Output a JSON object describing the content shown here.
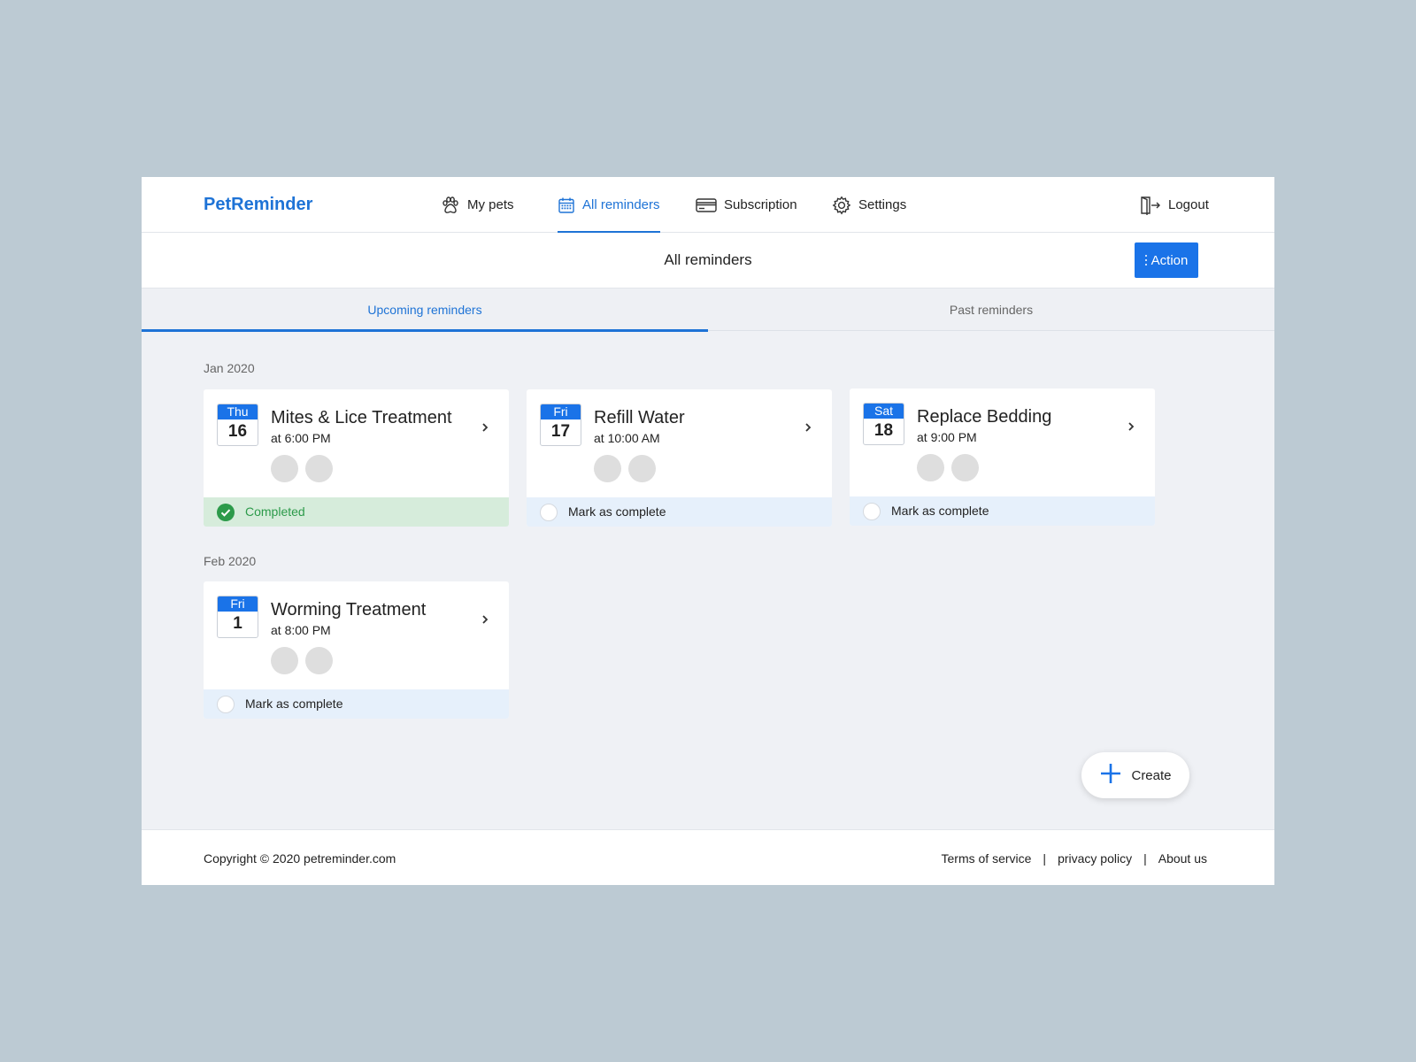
{
  "colors": {
    "accent": "#1a73e8",
    "page_background": "#bccad3",
    "completed_green": "#2c9a4a"
  },
  "nav": {
    "logo": "PetReminder",
    "items": [
      {
        "label": "My pets",
        "icon": "paw-icon"
      },
      {
        "label": "All reminders",
        "icon": "calendar-icon",
        "active": true
      },
      {
        "label": "Subscription",
        "icon": "credit-card-icon"
      },
      {
        "label": "Settings",
        "icon": "gear-icon"
      }
    ],
    "logout": {
      "label": "Logout",
      "icon": "logout-door-icon"
    }
  },
  "header": {
    "title": "All reminders",
    "action_label": "Action"
  },
  "tabs": [
    {
      "label": "Upcoming reminders",
      "active": true
    },
    {
      "label": "Past reminders",
      "active": false
    }
  ],
  "groups": [
    {
      "month": "Jan 2020",
      "reminders": [
        {
          "day": "Thu",
          "date": "16",
          "title": "Mites & Lice Treatment",
          "time": "at 6:00 PM",
          "status": "Completed",
          "completed": true
        },
        {
          "day": "Fri",
          "date": "17",
          "title": "Refill Water",
          "time": "at 10:00 AM",
          "status": "Mark as complete",
          "completed": false
        },
        {
          "day": "Sat",
          "date": "18",
          "title": "Replace Bedding",
          "time": "at 9:00 PM",
          "status": "Mark as complete",
          "completed": false
        }
      ]
    },
    {
      "month": "Feb 2020",
      "reminders": [
        {
          "day": "Fri",
          "date": "1",
          "title": "Worming Treatment",
          "time": "at 8:00 PM",
          "status": "Mark as complete",
          "completed": false
        }
      ]
    }
  ],
  "create": {
    "label": "Create",
    "icon": "plus-icon"
  },
  "footer": {
    "copyright": "Copyright © 2020 petreminder.com",
    "links": [
      "Terms of service",
      "privacy policy",
      "About us"
    ],
    "separator": "|"
  }
}
